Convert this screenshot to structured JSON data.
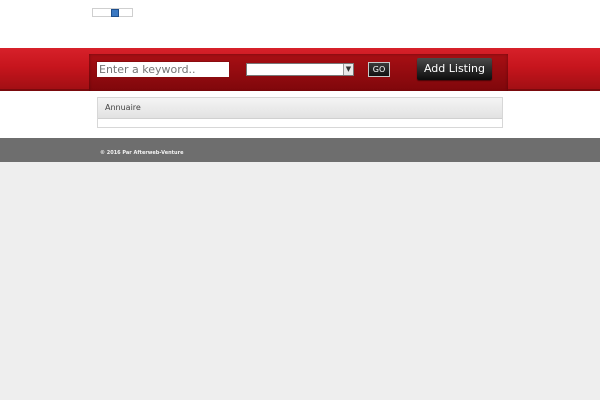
{
  "header": {
    "search_placeholder": "Enter a keyword..",
    "select_value": "",
    "go_label": "GO",
    "add_listing_label": "Add Listing",
    "brand_color": "#c7151d"
  },
  "main": {
    "panel_title": "Annuaire"
  },
  "footer": {
    "copyright": "© 2016 Par Afterweb-Venture"
  }
}
